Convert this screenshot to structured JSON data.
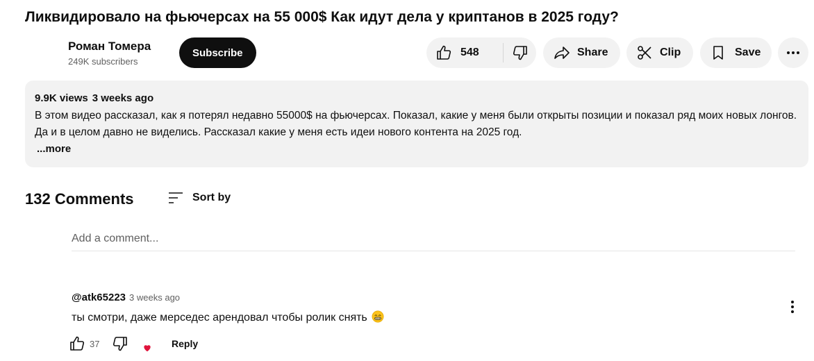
{
  "video": {
    "title": "Ликвидировало на фьючерсах на 55 000$ Как идут дела у криптанов в 2025 году?"
  },
  "channel": {
    "name": "Роман Томера",
    "subscribers": "249K subscribers",
    "subscribe_label": "Subscribe"
  },
  "actions": {
    "like_count": "548",
    "share_label": "Share",
    "clip_label": "Clip",
    "save_label": "Save"
  },
  "description": {
    "views": "9.9K views",
    "date": "3 weeks ago",
    "text": "В этом видео рассказал, как я потерял недавно 55000$ на фьючерсах. Показал, какие у меня были открыты позиции и показал ряд моих новых лонгов. Да и в целом давно не виделись. Рассказал какие у меня есть идеи нового контента на 2025 год.",
    "more_label": "...more"
  },
  "comments": {
    "count_label": "132 Comments",
    "sort_label": "Sort by",
    "add_placeholder": "Add a comment...",
    "items": [
      {
        "author": "@atk65223",
        "time": "3 weeks ago",
        "text": "ты смотри, даже мерседес арендовал чтобы ролик снять",
        "emoji": "grinning-face-icon",
        "likes": "37",
        "reply_label": "Reply"
      }
    ]
  },
  "colors": {
    "pill_bg": "#f2f2f2",
    "subscribe_bg": "#0f0f0f",
    "heart": "#e0143c",
    "secondary_text": "#606060"
  }
}
